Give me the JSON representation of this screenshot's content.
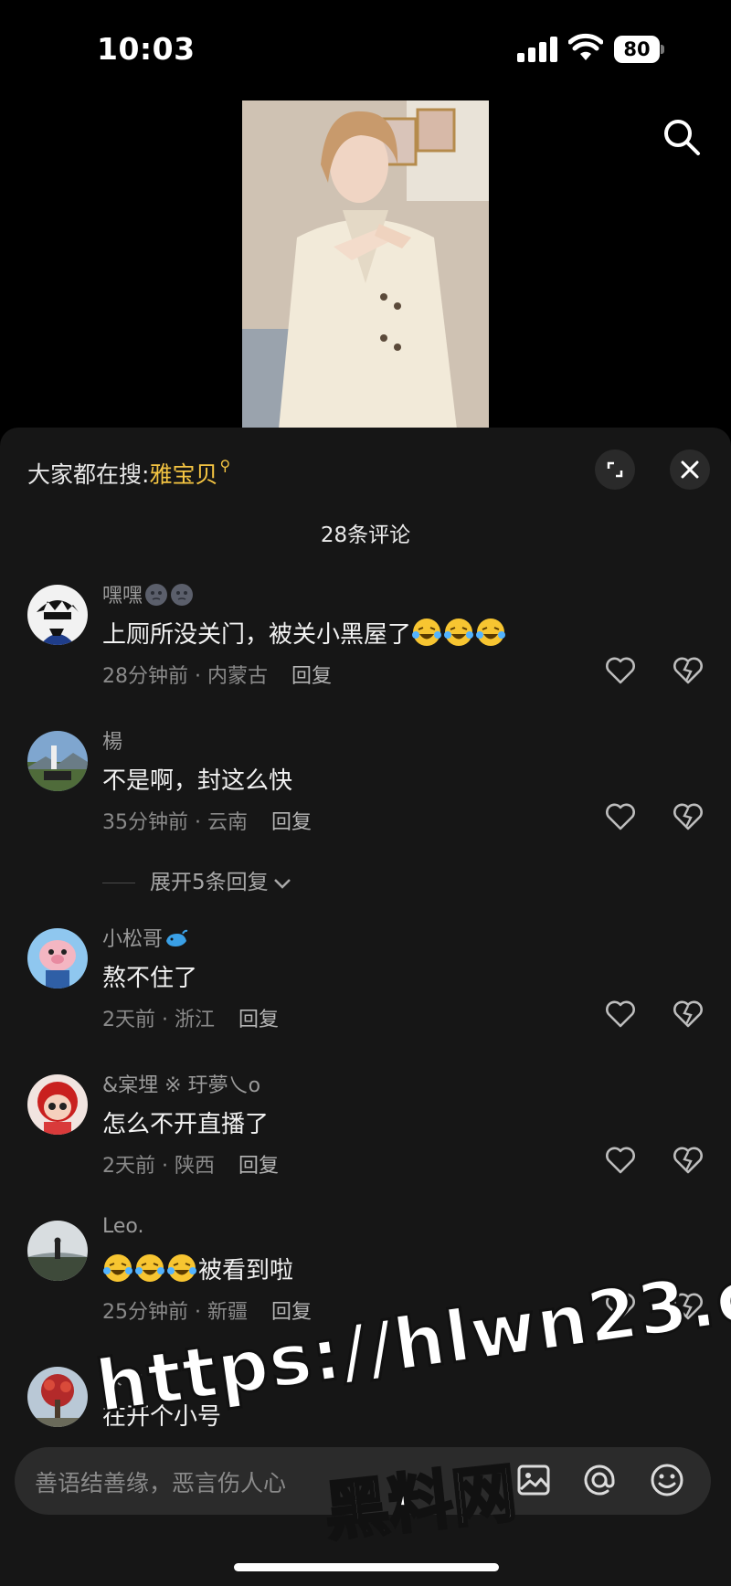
{
  "status_bar": {
    "time": "10:03",
    "battery": "80"
  },
  "header": {
    "search_icon": "search-icon"
  },
  "sheet": {
    "trending_prefix": "大家都在搜:",
    "trending_keyword": "雅宝贝",
    "comment_count": "28条评论"
  },
  "comments": [
    {
      "username": "嘿嘿",
      "text": "上厕所没关门，被关小黑屋了",
      "time_location": "28分钟前 · 内蒙古",
      "reply": "回复"
    },
    {
      "username": "楊",
      "text": "不是啊，封这么快",
      "time_location": "35分钟前 · 云南",
      "reply": "回复"
    },
    {
      "username": "小松哥",
      "text": "熬不住了",
      "time_location": "2天前 · 浙江",
      "reply": "回复"
    },
    {
      "username": "&宲埋 ※ 玗夢乀o",
      "text": "怎么不开直播了",
      "time_location": "2天前 · 陕西",
      "reply": "回复"
    },
    {
      "username": "Leo.",
      "text": "被看到啦",
      "time_location": "25分钟前 · 新疆",
      "reply": "回复"
    },
    {
      "username": "大个",
      "text": "在开个小号"
    }
  ],
  "expand_replies": "展开5条回复",
  "input": {
    "placeholder": "善语结善缘，恶言伤人心"
  },
  "watermark": {
    "url": "https://hlwn23.com",
    "name": "黑料网"
  },
  "colors": {
    "accent_keyword": "#f5c542",
    "sheet_bg": "#161616",
    "input_bg": "#2b2b2b"
  }
}
